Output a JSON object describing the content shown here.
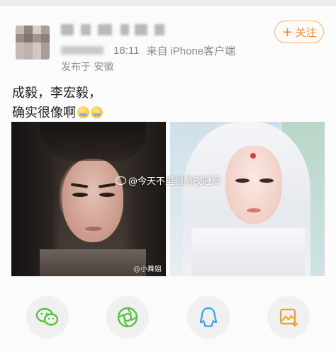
{
  "post": {
    "timestamp": "18:11",
    "source_prefix": "来自",
    "source_device": "iPhone客户端",
    "location": "发布于 安徽",
    "follow_label": "关注",
    "follow_plus": "+",
    "text_line1": "成毅，李宏毅，",
    "text_line2": "确实很像啊"
  },
  "images": {
    "left_watermark": "@小舞姐",
    "overlay_watermark": "@今天不里当熬夜冠军"
  },
  "share": {
    "icons": [
      "wechat-icon",
      "moments-icon",
      "qq-icon",
      "save-image-icon"
    ],
    "colors": {
      "wechat": "#55c33a",
      "moments": "#55c33a",
      "qq": "#3aa3e8",
      "save": "#f0a020"
    }
  },
  "colors": {
    "accent": "#ee8a2c",
    "source_link": "#5a7bb0"
  }
}
